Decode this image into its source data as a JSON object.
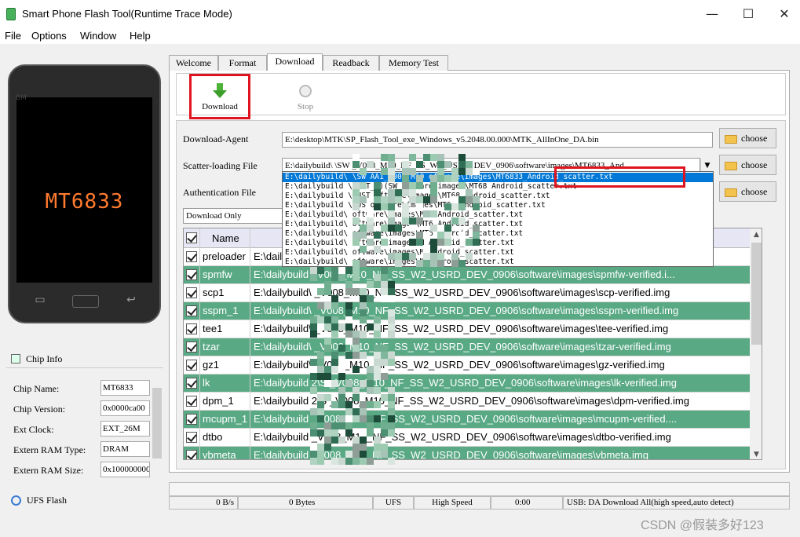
{
  "window": {
    "title": "Smart Phone Flash Tool(Runtime Trace Mode)",
    "minimize": "—",
    "maximize": "☐",
    "close": "✕"
  },
  "menu": [
    "File",
    "Options",
    "Window",
    "Help"
  ],
  "phone": {
    "brand": "BM",
    "chip": "MT6833"
  },
  "chip_info": {
    "header": "Chip Info",
    "rows": [
      {
        "label": "Chip Name:",
        "value": "MT6833"
      },
      {
        "label": "Chip Version:",
        "value": "0x0000ca00"
      },
      {
        "label": "Ext Clock:",
        "value": "EXT_26M"
      },
      {
        "label": "Extern RAM Type:",
        "value": "DRAM"
      },
      {
        "label": "Extern RAM Size:",
        "value": "0x100000000"
      }
    ],
    "storage": "UFS Flash"
  },
  "tabs": [
    "Welcome",
    "Format",
    "Download",
    "Readback",
    "Memory Test"
  ],
  "toolbar": {
    "download": "Download",
    "stop": "Stop"
  },
  "form": {
    "download_agent_label": "Download-Agent",
    "download_agent_value": "E:\\desktop\\MTK\\SP_Flash_Tool_exe_Windows_v5.2048.00.000\\MTK_AllInOne_DA.bin",
    "scatter_label": "Scatter-loading File",
    "scatter_value": "E:\\dailybuild\\  \\SW   _V008_M10_NF_SS_W2_USRD_DEV_0906\\software\\images\\MT6833_And",
    "auth_label": "Authentication File",
    "mode_value": "Download Only",
    "choose": "choose"
  },
  "dropdown": [
    "E:\\dailybuild\\  \\SW          AA1_V008_M10         oftware\\images\\MT6833_Android_scatter.txt",
    "E:\\dailybuild  \\CUST_        )(SW         oftware\\images\\MT68   Android_scatter.txt",
    "E:\\dailybuild  \\CUST                       oftware\\images\\MT68   Android_scatter.txt",
    "E:\\dailybuild  \\CUS                        oftware\\images\\MT68   Android_scatter.txt",
    "E:\\dailybuild\\                             oftware\\images\\MT6    Android_scatter.txt",
    "E:\\dailybuild\\                             oftware\\images\\MT6    Android_scatter.txt",
    "E:\\dailybuild\\                             oftware\\images\\MT6    Android_scatter.txt",
    "E:\\dailybuild\\                             oftware\\images\\M      Android_scatter.txt",
    "E:\\dailybuild\\                             oftware\\images\\M      Android_scatter.txt",
    "E:\\dailybuild\\                             oftware\\images\\M      Android_scatter.txt"
  ],
  "table": {
    "col_name": "Name",
    "rows": [
      {
        "name": "preloader",
        "loc": "E:\\daily                                                                              S969..."
      },
      {
        "name": "spmfw",
        "loc": "E:\\dailybuild                 _V008_M10_NF_SS_W2_USRD_DEV_0906\\software\\images\\spmfw-verified.i..."
      },
      {
        "name": "scp1",
        "loc": "E:\\dailybuild\\                 _V008_M10_NF_SS_W2_USRD_DEV_0906\\software\\images\\scp-verified.img"
      },
      {
        "name": "sspm_1",
        "loc": "E:\\dailybuild\\                 _V008_M10_NF_SS_W2_USRD_DEV_0906\\software\\images\\sspm-verified.img"
      },
      {
        "name": "tee1",
        "loc": "E:\\dailybuild\\                 _V008_M10_NF_SS_W2_USRD_DEV_0906\\software\\images\\tee-verified.img"
      },
      {
        "name": "tzar",
        "loc": "E:\\dailybuild\\                 _V008_M10_NF_SS_W2_USRD_DEV_0906\\software\\images\\tzar-verified.img"
      },
      {
        "name": "gz1",
        "loc": "E:\\dailybuild\\                 _V008_M10_NF_SS_W2_USRD_DEV_0906\\software\\images\\gz-verified.img"
      },
      {
        "name": "lk",
        "loc": "E:\\dailybuild   2\\S             _V008_M10_NF_SS_W2_USRD_DEV_0906\\software\\images\\lk-verified.img"
      },
      {
        "name": "dpm_1",
        "loc": "E:\\dailybuild   2\\S             _V008_M10_NF_SS_W2_USRD_DEV_0906\\software\\images\\dpm-verified.img"
      },
      {
        "name": "mcupm_1",
        "loc": "E:\\dailybuild                 _V008_M10_NF_SS_W2_USRD_DEV_0906\\software\\images\\mcupm-verified...."
      },
      {
        "name": "dtbo",
        "loc": "E:\\dailybuild                 _V008_M10_NF_SS_W2_USRD_DEV_0906\\software\\images\\dtbo-verified.img"
      },
      {
        "name": "vbmeta",
        "loc": "E:\\dailybuild                 _V008_M10_NF_SS_W2_USRD_DEV_0906\\software\\images\\vbmeta.img"
      }
    ]
  },
  "status": {
    "speed": "0 B/s",
    "bytes": "0 Bytes",
    "storage": "UFS",
    "mode": "High Speed",
    "time": "0:00",
    "usb": "USB: DA Download All(high speed,auto detect)"
  },
  "watermark": "CSDN @假装多好123",
  "colors": {
    "row_green": "#5aa985",
    "selection": "#0078d7",
    "highlight": "#e0141e",
    "chip_text": "#ff7a2f"
  }
}
